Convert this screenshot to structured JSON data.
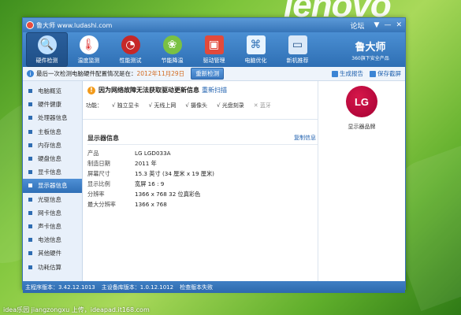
{
  "background": {
    "brand_text": "lenovo",
    "caption": "idea乐园 jiangzongxu 上传，ideapad.it168.com"
  },
  "window": {
    "title": "鲁大师 www.ludashi.com",
    "title_links": [
      "论坛",
      "▼",
      "—",
      "✕"
    ],
    "accent_color": "#3674b8"
  },
  "toolbar": {
    "items": [
      {
        "label": "硬件检测",
        "icon": "magnifier-icon",
        "active": true
      },
      {
        "label": "温度监测",
        "icon": "thermometer-icon",
        "active": false
      },
      {
        "label": "性能测试",
        "icon": "gauge-icon",
        "active": false
      },
      {
        "label": "节能降温",
        "icon": "leaf-icon",
        "active": false
      },
      {
        "label": "驱动管理",
        "icon": "toolbox-icon",
        "active": false
      },
      {
        "label": "电脑优化",
        "icon": "broom-icon",
        "active": false
      },
      {
        "label": "新机推荐",
        "icon": "monitor-icon",
        "active": false
      }
    ],
    "logo_text": "鲁大师",
    "logo_sub": "360旗下安全产品"
  },
  "status": {
    "text": "最后一次检测电脑硬件配置情况是在：",
    "date": "2012年11月29日",
    "recheck_label": "重新检测",
    "report_label": "生成报告",
    "save_screenshot_label": "保存截屏"
  },
  "sidebar": {
    "items": [
      {
        "label": "电脑概览",
        "active": false
      },
      {
        "label": "硬件健康",
        "active": false
      },
      {
        "label": "处理器信息",
        "active": false
      },
      {
        "label": "主板信息",
        "active": false
      },
      {
        "label": "内存信息",
        "active": false
      },
      {
        "label": "硬盘信息",
        "active": false
      },
      {
        "label": "显卡信息",
        "active": false
      },
      {
        "label": "显示器信息",
        "active": true
      },
      {
        "label": "光驱信息",
        "active": false
      },
      {
        "label": "网卡信息",
        "active": false
      },
      {
        "label": "声卡信息",
        "active": false
      },
      {
        "label": "电池信息",
        "active": false
      },
      {
        "label": "其他硬件",
        "active": false
      },
      {
        "label": "功耗估算",
        "active": false
      }
    ]
  },
  "main": {
    "warning": "因为网络故障无法获取驱动更新信息",
    "rescan_label": "重新扫描",
    "features_label": "功能：",
    "features": [
      {
        "label": "√ 独立显卡",
        "enabled": true
      },
      {
        "label": "√ 无线上网",
        "enabled": true
      },
      {
        "label": "√ 摄像头",
        "enabled": true
      },
      {
        "label": "√ 光盘刻录",
        "enabled": true
      },
      {
        "label": "✕ 蓝牙",
        "enabled": false
      }
    ],
    "section_title": "显示器信息",
    "copy_label": "复制信息",
    "rows": [
      {
        "key": "产品",
        "value": "LG LGD033A"
      },
      {
        "key": "制造日期",
        "value": "2011 年"
      },
      {
        "key": "屏幕尺寸",
        "value": "15.3 英寸 (34 厘米 x 19 厘米)"
      },
      {
        "key": "显示比例",
        "value": "宽屏 16 : 9"
      },
      {
        "key": "分辨率",
        "value": "1366 x 768 32 位真彩色"
      },
      {
        "key": "最大分辨率",
        "value": "1366 x 768"
      }
    ]
  },
  "right_panel": {
    "brand_logo_text": "LG",
    "brand_caption": "显示器品牌"
  },
  "footer": {
    "items": [
      "主程序版本：3.42.12.1013",
      "主设备库版本：1.0.12.1012",
      "检查版本失败"
    ]
  }
}
